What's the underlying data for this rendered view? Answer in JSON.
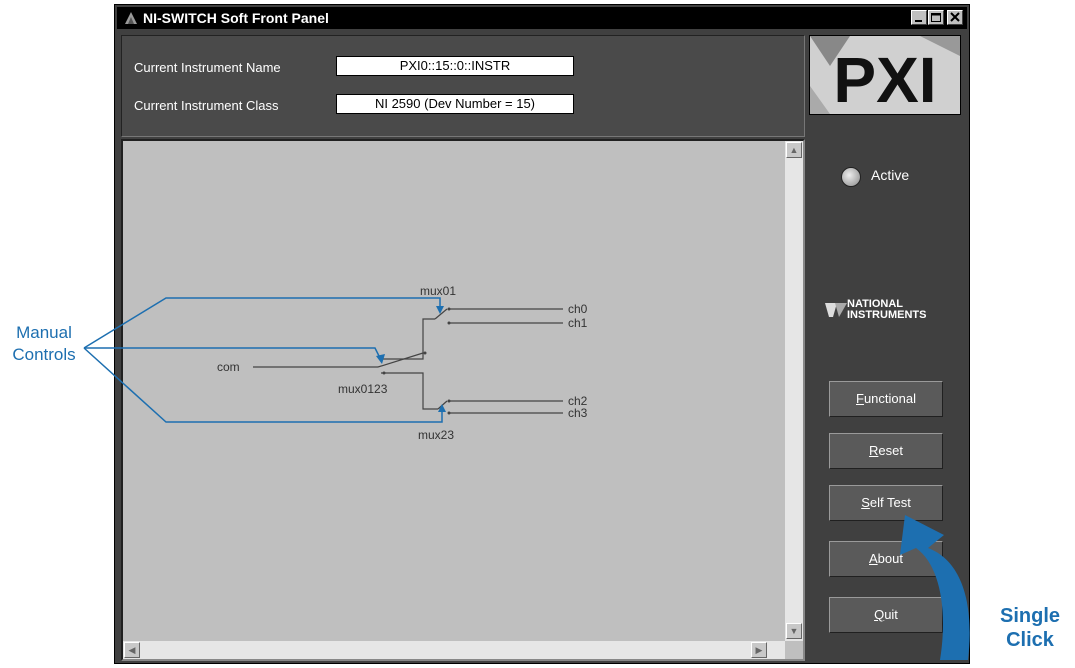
{
  "window": {
    "title": "NI-SWITCH Soft Front Panel"
  },
  "info": {
    "name_label": "Current Instrument Name",
    "name_value": "PXI0::15::0::INSTR",
    "class_label": "Current Instrument Class",
    "class_value": "NI 2590 (Dev Number = 15)"
  },
  "logo": {
    "text": "PXI"
  },
  "diagram": {
    "com": "com",
    "mux01": "mux01",
    "mux0123": "mux0123",
    "mux23": "mux23",
    "ch0": "ch0",
    "ch1": "ch1",
    "ch2": "ch2",
    "ch3": "ch3"
  },
  "side": {
    "status_label": "Active",
    "brand_line1": "NATIONAL",
    "brand_line2": "INSTRUMENTS"
  },
  "buttons": {
    "functional": {
      "hotkey": "F",
      "rest": "unctional"
    },
    "reset": {
      "hotkey": "R",
      "rest": "eset"
    },
    "self_test": {
      "hotkey": "S",
      "rest": "elf Test"
    },
    "about": {
      "hotkey": "A",
      "rest": "bout"
    },
    "quit": {
      "hotkey": "Q",
      "rest": "uit"
    }
  },
  "annotations": {
    "manual_line1": "Manual",
    "manual_line2": "Controls",
    "click_line1": "Single",
    "click_line2": "Click"
  },
  "colors": {
    "annotation_blue": "#1d6fb0",
    "window_bg": "#404040",
    "canvas_bg": "#bfbfbf"
  }
}
